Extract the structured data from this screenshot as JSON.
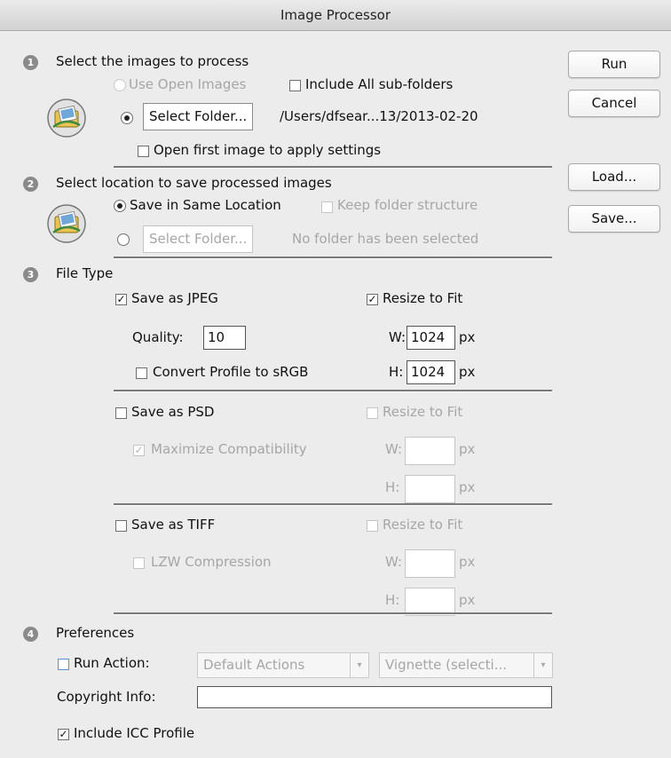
{
  "window": {
    "title": "Image Processor"
  },
  "buttons": {
    "run": "Run",
    "cancel": "Cancel",
    "load": "Load...",
    "save": "Save..."
  },
  "section1": {
    "number": "1",
    "heading": "Select the images to process",
    "use_open_images": "Use Open Images",
    "include_subfolders": "Include All sub-folders",
    "select_folder": "Select Folder...",
    "folder_path": "/Users/dfsear...13/2013-02-20",
    "open_first_image": "Open first image to apply settings"
  },
  "section2": {
    "number": "2",
    "heading": "Select location to save processed images",
    "save_same_location": "Save in Same Location",
    "keep_folder_structure": "Keep folder structure",
    "select_folder": "Select Folder...",
    "no_folder": "No folder has been selected"
  },
  "section3": {
    "number": "3",
    "heading": "File Type",
    "jpeg": {
      "save_label": "Save as JPEG",
      "checked": true,
      "resize_label": "Resize to Fit",
      "resize_checked": true,
      "quality_label": "Quality:",
      "quality_value": "10",
      "convert_label": "Convert Profile to sRGB",
      "w_label": "W:",
      "w_value": "1024",
      "h_label": "H:",
      "h_value": "1024",
      "unit": "px"
    },
    "psd": {
      "save_label": "Save as PSD",
      "resize_label": "Resize to Fit",
      "maximize_label": "Maximize Compatibility",
      "w_label": "W:",
      "h_label": "H:",
      "unit": "px"
    },
    "tiff": {
      "save_label": "Save as TIFF",
      "resize_label": "Resize to Fit",
      "lzw_label": "LZW Compression",
      "w_label": "W:",
      "h_label": "H:",
      "unit": "px"
    }
  },
  "section4": {
    "number": "4",
    "heading": "Preferences",
    "run_action": "Run Action:",
    "action_set": "Default Actions",
    "action": "Vignette (selecti...",
    "copyright_label": "Copyright Info:",
    "copyright_value": "",
    "include_icc": "Include ICC Profile"
  },
  "icons": [
    "folder-photo-icon",
    "folder-photo-icon"
  ],
  "marks": {
    "check": "✓",
    "dropdown": "▾"
  }
}
